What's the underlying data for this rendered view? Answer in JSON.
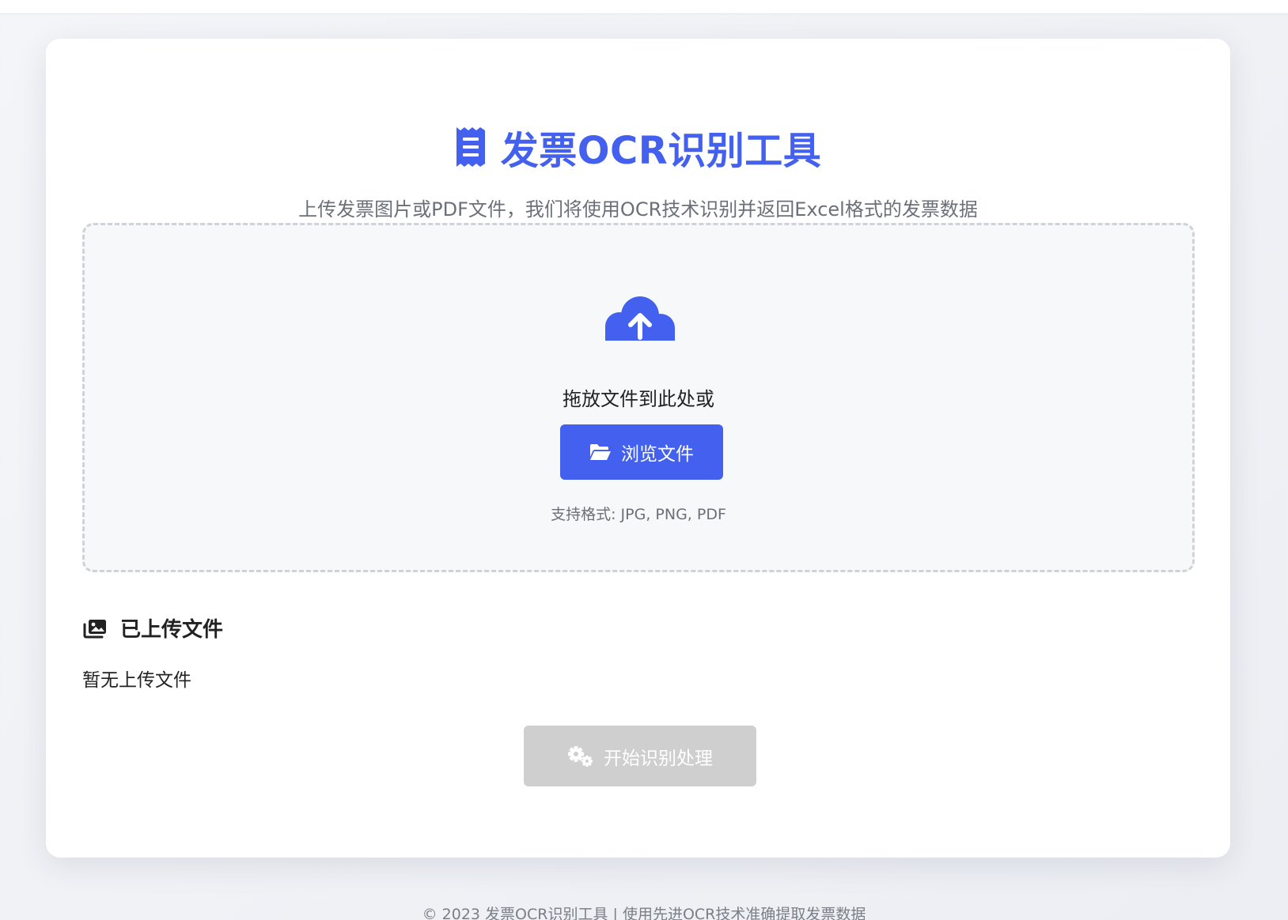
{
  "header": {
    "title": "发票OCR识别工具",
    "title_icon": "receipt-icon",
    "subtitle": "上传发票图片或PDF文件，我们将使用OCR技术识别并返回Excel格式的发票数据"
  },
  "dropzone": {
    "icon": "cloud-upload-icon",
    "drop_text": "拖放文件到此处或",
    "browse_label": "浏览文件",
    "browse_icon": "folder-open-icon",
    "formats_text": "支持格式: JPG, PNG, PDF"
  },
  "uploaded": {
    "icon": "images-icon",
    "title": "已上传文件",
    "empty_text": "暂无上传文件"
  },
  "process": {
    "label": "开始识别处理",
    "icon": "gears-icon",
    "enabled": false
  },
  "footer": {
    "text": "© 2023 发票OCR识别工具 | 使用先进OCR技术准确提取发票数据"
  },
  "colors": {
    "accent": "#4361ee",
    "disabled": "#cfcfcf",
    "muted_text": "#6b6f78"
  }
}
